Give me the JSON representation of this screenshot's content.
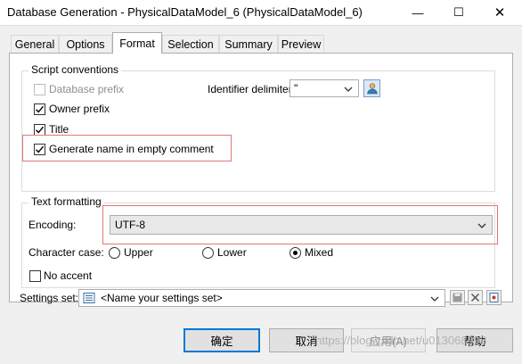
{
  "window": {
    "title": "Database Generation - PhysicalDataModel_6 (PhysicalDataModel_6)",
    "minimize_glyph": "—",
    "maximize_glyph": "☐",
    "close_glyph": "✕"
  },
  "tabs": [
    "General",
    "Options",
    "Format",
    "Selection",
    "Summary",
    "Preview"
  ],
  "active_tab": "Format",
  "script_conventions": {
    "group_label": "Script conventions",
    "database_prefix": {
      "label": "Database prefix",
      "checked": false,
      "enabled": false
    },
    "owner_prefix": {
      "label": "Owner prefix",
      "checked": true
    },
    "title": {
      "label": "Title",
      "checked": true
    },
    "generate_name": {
      "label": "Generate name in empty comment",
      "checked": true
    },
    "identifier_delimiter": {
      "label": "Identifier delimiter:",
      "value": "\""
    }
  },
  "text_formatting": {
    "group_label": "Text formatting",
    "encoding": {
      "label": "Encoding:",
      "value": "UTF-8"
    },
    "character_case": {
      "label": "Character case:",
      "options": [
        "Upper",
        "Lower",
        "Mixed"
      ],
      "selected": "Mixed"
    },
    "no_accent": {
      "label": "No accent",
      "checked": false
    }
  },
  "settings_set": {
    "label": "Settings set:",
    "placeholder": "<Name your settings set>"
  },
  "buttons": {
    "ok": "确定",
    "cancel": "取消",
    "apply": "应用(A)",
    "help": "帮助"
  },
  "watermark": "https://blog.csdn.net/u013068998",
  "colors": {
    "highlight_box": "#e0777a",
    "default_button_border": "#0078d7"
  }
}
